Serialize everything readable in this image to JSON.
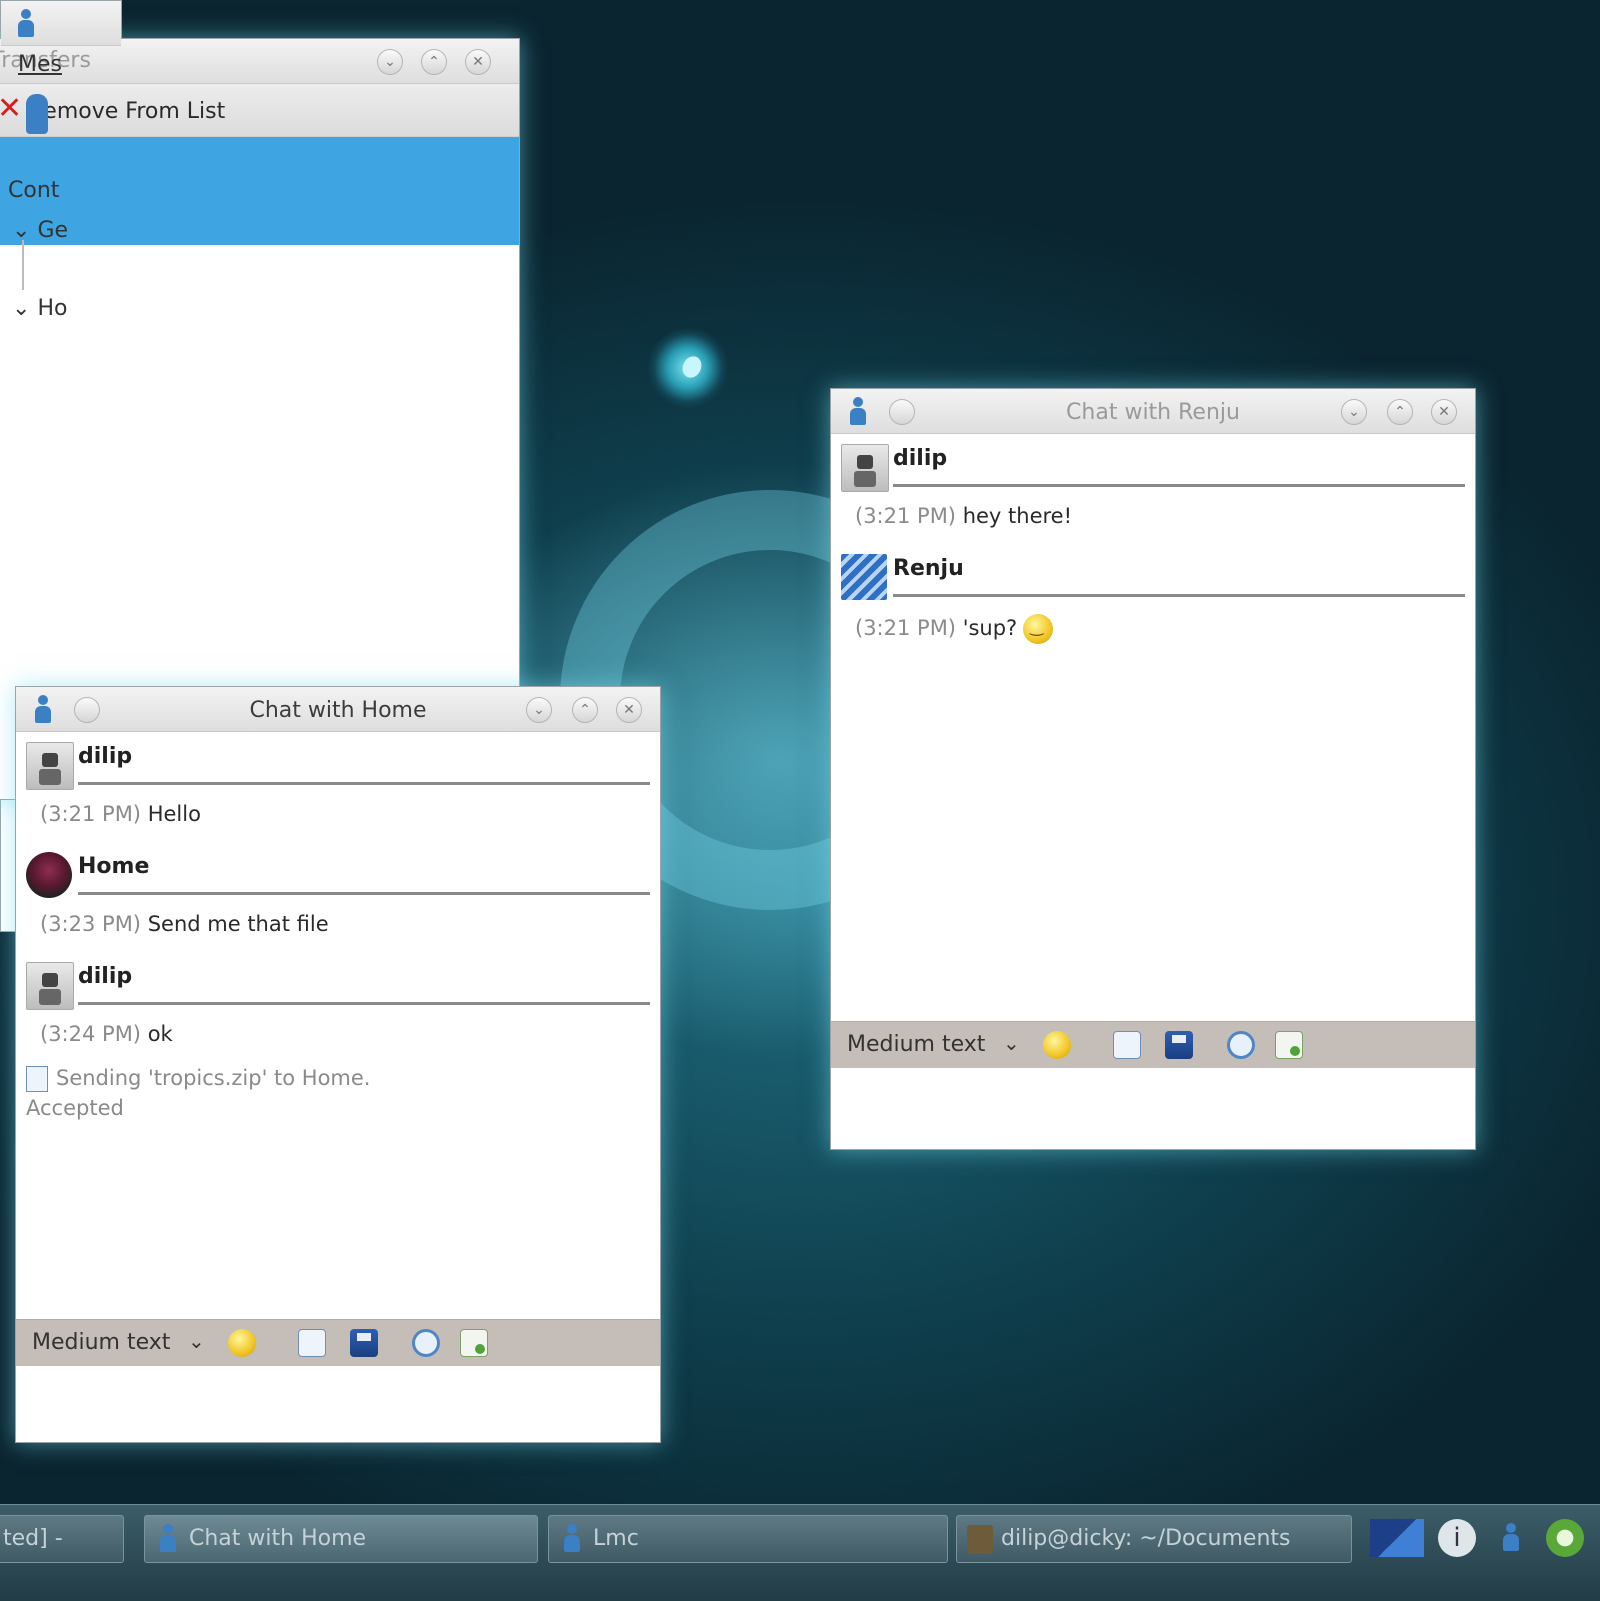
{
  "transfers_window": {
    "title": "Transfers",
    "remove_label": "Remove From List"
  },
  "chat_home": {
    "title": "Chat with Home",
    "messages": [
      {
        "sender": "dilip",
        "time": "(3:21 PM)",
        "text": "Hello"
      },
      {
        "sender": "Home",
        "time": "(3:23 PM)",
        "text": "Send me that file"
      },
      {
        "sender": "dilip",
        "time": "(3:24 PM)",
        "text": "ok"
      }
    ],
    "file_status": "Sending 'tropics.zip' to Home.",
    "file_result": "Accepted",
    "format_select": "Medium text"
  },
  "chat_renju": {
    "title": "Chat with Renju",
    "messages": [
      {
        "sender": "dilip",
        "time": "(3:21 PM)",
        "text": "hey there!"
      },
      {
        "sender": "Renju",
        "time": "(3:21 PM)",
        "text": "'sup?"
      }
    ],
    "format_select": "Medium text"
  },
  "contacts_window": {
    "menu": "Mes",
    "contacts_label": "Cont",
    "group1": "Ge",
    "group2": "Ho"
  },
  "taskbar": {
    "left_fragment": "ted] - ",
    "tasks": [
      "Chat with Home",
      "Lmc",
      "dilip@dicky: ~/Documents"
    ]
  },
  "colors": {
    "selection": "#3ea4e2",
    "format_bar": "#c4bdb8",
    "desktop": "#1f6d80"
  },
  "icons": [
    "app-icon",
    "minimize-icon",
    "maximize-icon",
    "close-icon",
    "smiley-icon",
    "document-icon",
    "save-icon",
    "refresh-icon",
    "send-file-icon",
    "remove-icon"
  ]
}
